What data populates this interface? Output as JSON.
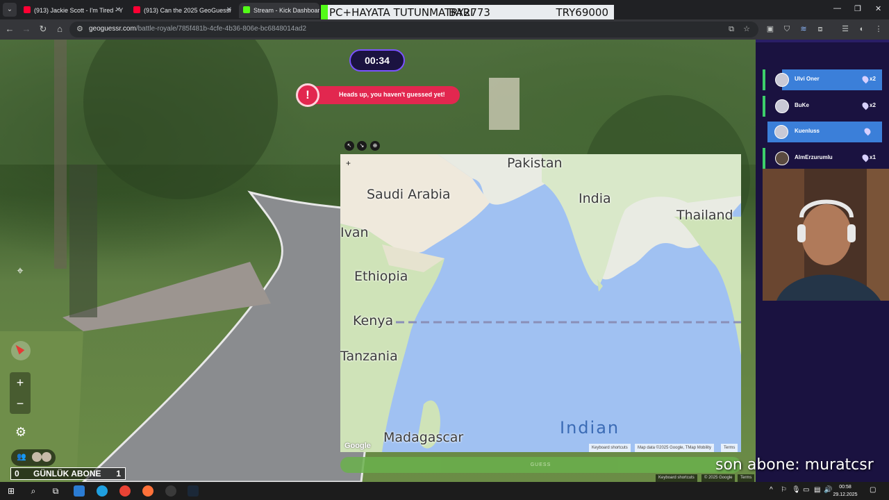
{
  "browser": {
    "tabs": [
      {
        "title": "(913) Jackie Scott - I'm Tired - Y",
        "favicon_color": "#ff0033",
        "active": false
      },
      {
        "title": "(913) Can the 2025 GeoGuessr",
        "favicon_color": "#ff0033",
        "active": false
      },
      {
        "title": "Stream - Kick Dashboard",
        "favicon_color": "#53fc18",
        "active": true
      }
    ],
    "stream_overlay": {
      "left_text": "PC+HAYATA TUTUNMA BARI",
      "mid_text": "TRY2773",
      "right_text": "TRY69000"
    },
    "url_host": "geoguessr.com",
    "url_path": "/battle-royale/785f481b-4cfe-4b36-806e-bc6848014ad2"
  },
  "game": {
    "timer": "00:34",
    "alert": "Heads up, you haven't guessed yet!",
    "guess_button": "GUESS",
    "map": {
      "labels": [
        "Pakistan",
        "Saudi Arabia",
        "India",
        "Thailand",
        "Ethiopia",
        "Kenya",
        "Tanzania",
        "Madagascar",
        "Indian",
        "Ivan"
      ],
      "google_logo": "Google",
      "attribution": [
        "Keyboard shortcuts",
        "Map data ©2025 Google, TMap Mobility",
        "Terms"
      ]
    },
    "street_attribution": [
      "Keyboard shortcuts",
      "© 2025 Google",
      "Terms"
    ]
  },
  "players": [
    {
      "name": "Ulvi Oner",
      "count": "x2",
      "highlight": true
    },
    {
      "name": "BuKe",
      "count": "x2",
      "highlight": false
    },
    {
      "name": "Kuenluss",
      "count": "",
      "highlight": true
    },
    {
      "name": "AlmErzurumlu",
      "count": "x1",
      "highlight": false
    }
  ],
  "overlay": {
    "sub_count_left": "0",
    "sub_label": "GÜNLÜK ABONE",
    "sub_count_right": "1",
    "last_sub": "son abone: muratcsr"
  },
  "taskbar": {
    "time": "00:58",
    "date": "29.12.2025"
  },
  "colors": {
    "accent_purple": "#7a52ff",
    "alert_red": "#e2274f",
    "guess_green": "#6ab04c",
    "highlight_blue": "#3b7fd9"
  }
}
